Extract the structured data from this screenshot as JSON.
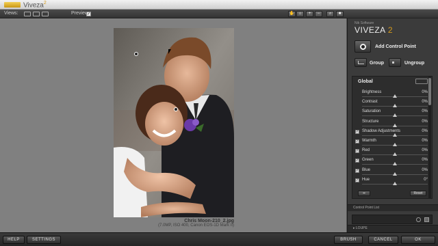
{
  "window": {
    "title": "Viveza",
    "version": "2"
  },
  "toolbar": {
    "views_label": "Views:",
    "preview_label": "Preview:",
    "preview_checked": "✓"
  },
  "image": {
    "filename": "Chris Moon-210_2.jpg",
    "meta": "(7.0MP, ISO 400, Canon EOS-1D Mark II)"
  },
  "panel": {
    "brand_small": "Nik Software",
    "brand": "VIVEZA",
    "brand_version": "2",
    "add_control_point": "Add Control Point",
    "group": "Group",
    "ungroup": "Ungroup",
    "global_title": "Global",
    "sliders": [
      {
        "label": "Brightness",
        "value": "0%",
        "checkbox": false
      },
      {
        "label": "Contrast",
        "value": "0%",
        "checkbox": false
      },
      {
        "label": "Saturation",
        "value": "0%",
        "checkbox": false
      },
      {
        "label": "Structure",
        "value": "0%",
        "checkbox": false
      },
      {
        "label": "Shadow Adjustments",
        "value": "0%",
        "checkbox": true
      },
      {
        "label": "Warmth",
        "value": "0%",
        "checkbox": true
      },
      {
        "label": "Red",
        "value": "0%",
        "checkbox": true
      },
      {
        "label": "Green",
        "value": "0%",
        "checkbox": true
      },
      {
        "label": "Blue",
        "value": "0%",
        "checkbox": true
      },
      {
        "label": "Hue",
        "value": "0°",
        "checkbox": true
      }
    ],
    "reset": "Reset",
    "control_point_list": "Control Point List",
    "loupe": "LOUPE"
  },
  "bottom": {
    "help": "HELP",
    "settings": "SETTINGS",
    "brush": "BRUSH",
    "cancel": "CANCEL",
    "ok": "OK"
  },
  "colors": {
    "accent": "#d49a1c",
    "canvas": "#808080",
    "panel": "#3b3b3b"
  }
}
